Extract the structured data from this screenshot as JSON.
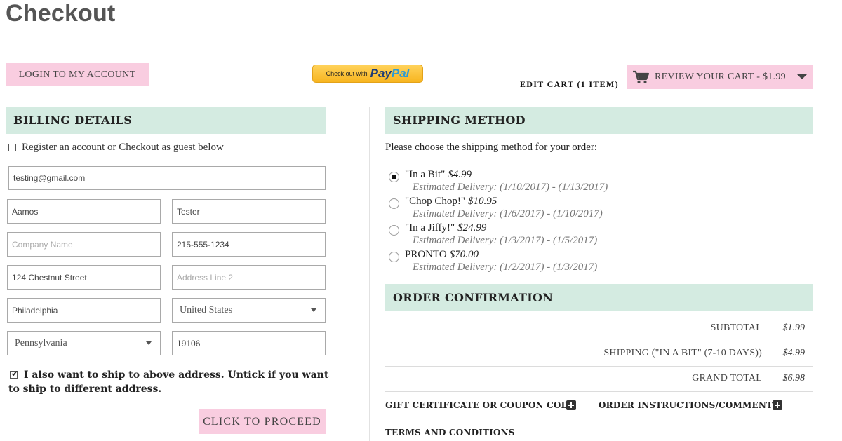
{
  "page": {
    "title": "Checkout"
  },
  "header": {
    "login_label": "LOGIN TO MY ACCOUNT",
    "paypal_small": "Check out with",
    "paypal_pay": "Pay",
    "paypal_pal": "Pal",
    "edit_cart_label": "EDIT CART (1 ITEM)",
    "review_cart_label": "REVIEW YOUR CART - $1.99"
  },
  "billing": {
    "heading": "BILLING DETAILS",
    "register_label": "Register an account or Checkout as guest below",
    "register_checked": false,
    "email": {
      "value": "testing@gmail.com"
    },
    "first_name": {
      "value": "Aamos"
    },
    "last_name": {
      "value": "Tester"
    },
    "company": {
      "placeholder": "Company Name"
    },
    "phone": {
      "value": "215-555-1234"
    },
    "address1": {
      "value": "124 Chestnut Street"
    },
    "address2": {
      "placeholder": "Address Line 2"
    },
    "city": {
      "value": "Philadelphia"
    },
    "country": {
      "value": "United States"
    },
    "state": {
      "value": "Pennsylvania"
    },
    "zip": {
      "value": "19106"
    },
    "ship_same_label": "I also want to ship to above address. Untick if you want to ship to different address.",
    "ship_same_checked": true,
    "proceed_label": "CLICK TO PROCEED"
  },
  "shipping": {
    "heading": "SHIPPING METHOD",
    "intro": "Please choose the shipping method for your order:",
    "options": [
      {
        "name": "\"In a Bit\"",
        "price": "$4.99",
        "estimate": "Estimated Delivery: (1/10/2017) - (1/13/2017)",
        "selected": true
      },
      {
        "name": "\"Chop Chop!\"",
        "price": "$10.95",
        "estimate": "Estimated Delivery: (1/6/2017) - (1/10/2017)",
        "selected": false
      },
      {
        "name": "\"In a Jiffy!\"",
        "price": "$24.99",
        "estimate": "Estimated Delivery: (1/3/2017) - (1/5/2017)",
        "selected": false
      },
      {
        "name": "PRONTO",
        "price": "$70.00",
        "estimate": "Estimated Delivery: (1/2/2017) - (1/3/2017)",
        "selected": false
      }
    ]
  },
  "order": {
    "heading": "ORDER CONFIRMATION",
    "rows": [
      {
        "label": "SUBTOTAL",
        "value": "$1.99"
      },
      {
        "label": "SHIPPING (\"IN A BIT\" (7-10 DAYS))",
        "value": "$4.99"
      },
      {
        "label": "GRAND TOTAL",
        "value": "$6.98"
      }
    ],
    "coupon_label": "GIFT CERTIFICATE OR COUPON CODE",
    "instructions_label": "ORDER INSTRUCTIONS/COMMENTS",
    "terms_label": "TERMS AND CONDITIONS"
  },
  "colors": {
    "accent_pink": "#f9cde0",
    "section_green": "#d4ebe1"
  },
  "icons": [
    "cart-icon",
    "chevron-down-icon",
    "plus-icon",
    "paypal-logo"
  ]
}
